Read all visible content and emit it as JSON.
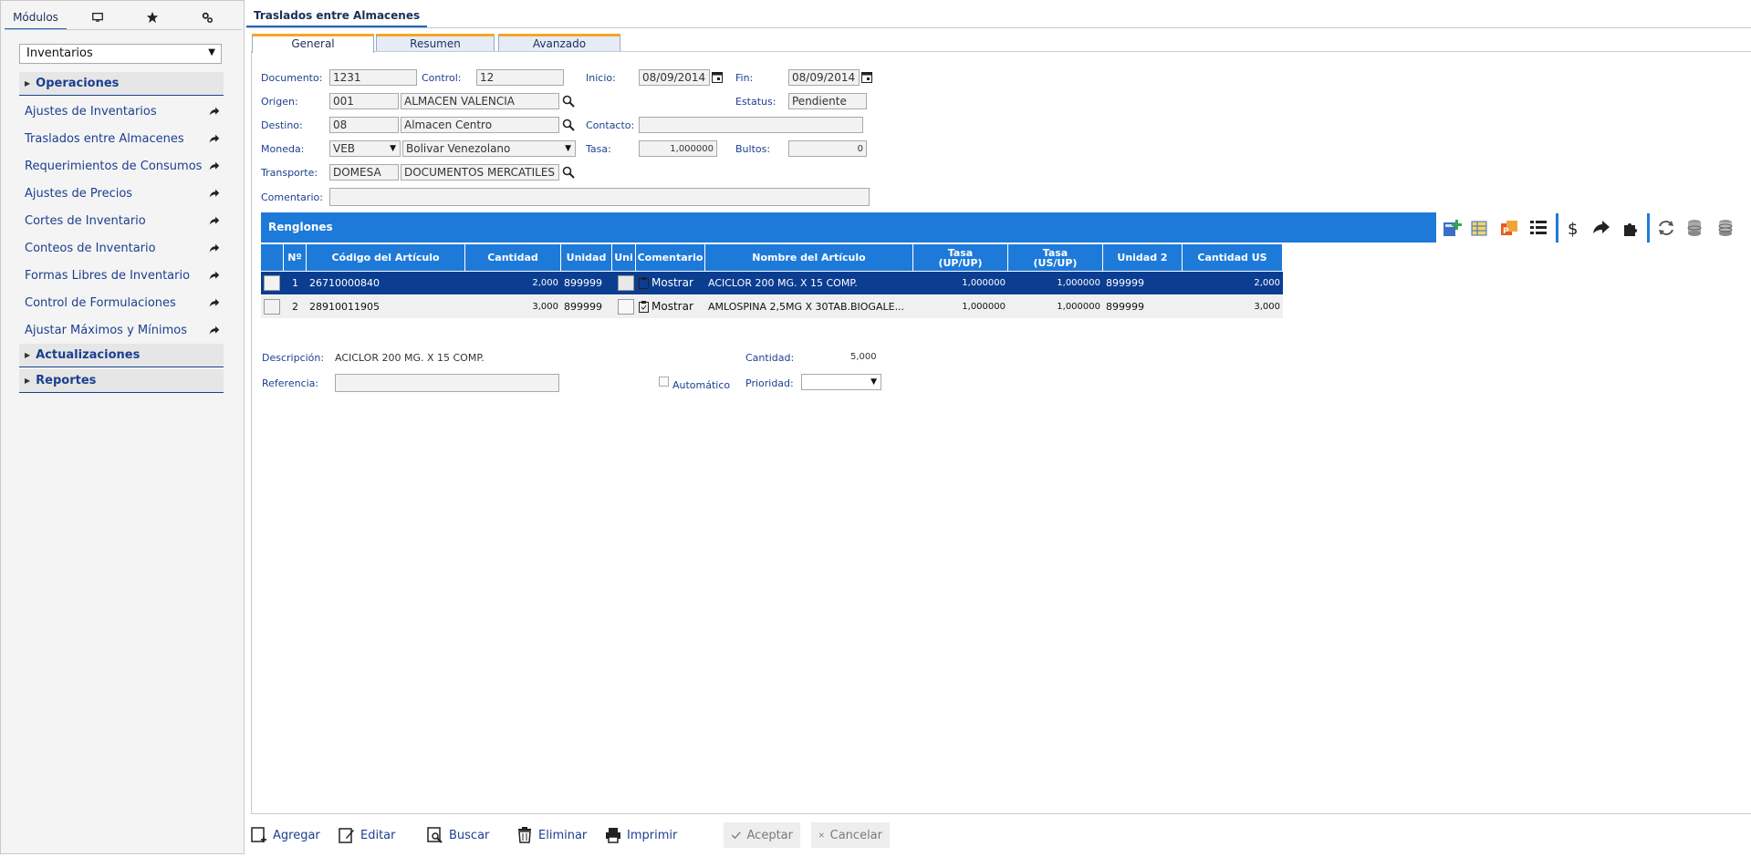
{
  "sidebar": {
    "tab_modulos": "Módulos",
    "icons": [
      "desktop-icon",
      "star-icon",
      "gear-icon"
    ],
    "module_select": "Inventarios",
    "sections": {
      "operaciones": "Operaciones",
      "actualizaciones": "Actualizaciones",
      "reportes": "Reportes"
    },
    "items": [
      "Ajustes de Inventarios",
      "Traslados entre Almacenes",
      "Requerimientos de Consumos",
      "Ajustes de Precios",
      "Cortes de Inventario",
      "Conteos de Inventario",
      "Formas Libres de Inventario",
      "Control de Formulaciones",
      "Ajustar Máximos y Mínimos"
    ]
  },
  "main": {
    "title": "Traslados entre Almacenes",
    "tabs": [
      "General",
      "Resumen",
      "Avanzado"
    ]
  },
  "form": {
    "documento_label": "Documento:",
    "documento": "1231",
    "control_label": "Control:",
    "control": "12",
    "inicio_label": "Inicio:",
    "inicio": "08/09/2014",
    "fin_label": "Fin:",
    "fin": "08/09/2014",
    "origen_label": "Origen:",
    "origen_code": "001",
    "origen_name": "ALMACEN VALENCIA",
    "estatus_label": "Estatus:",
    "estatus": "Pendiente",
    "destino_label": "Destino:",
    "destino_code": "08",
    "destino_name": "Almacen Centro",
    "contacto_label": "Contacto:",
    "contacto": "",
    "moneda_label": "Moneda:",
    "moneda_code": "VEB",
    "moneda_name": "Bolivar Venezolano",
    "tasa_label": "Tasa:",
    "tasa": "1,000000",
    "bultos_label": "Bultos:",
    "bultos": "0",
    "transporte_label": "Transporte:",
    "transporte_code": "DOMESA",
    "transporte_name": "DOCUMENTOS MERCATILES",
    "comentario_label": "Comentario:",
    "comentario": ""
  },
  "grid": {
    "title": "Renglones",
    "toolbar_icons": [
      "add-item-icon",
      "edit-grid-icon",
      "office-icon",
      "list-icon",
      "dollar-icon",
      "forward-icon",
      "puzzle-icon",
      "refresh-icon",
      "database-icon",
      "database-stack-icon"
    ],
    "headers": [
      "Nº",
      "Código del Artículo",
      "Cantidad",
      "Unidad",
      "Uni",
      "Comentario",
      "Nombre del Artículo",
      "Tasa\n(UP/UP)",
      "Tasa\n(US/UP)",
      "Unidad 2",
      "Cantidad US"
    ],
    "rows": [
      {
        "n": "1",
        "codigo": "26710000840",
        "cantidad": "2,000",
        "unidad": "899999",
        "comentario": "Mostrar",
        "nombre": "ACICLOR 200 MG. X 15 COMP.",
        "tasa1": "1,000000",
        "tasa2": "1,000000",
        "unidad2": "899999",
        "cantidad_us": "2,000"
      },
      {
        "n": "2",
        "codigo": "28910011905",
        "cantidad": "3,000",
        "unidad": "899999",
        "comentario": "Mostrar",
        "nombre": "AMLOSPINA 2,5MG X 30TAB.BIOGALE...",
        "tasa1": "1,000000",
        "tasa2": "1,000000",
        "unidad2": "899999",
        "cantidad_us": "3,000"
      }
    ]
  },
  "detail": {
    "descripcion_label": "Descripción:",
    "descripcion": "ACICLOR 200 MG. X 15 COMP.",
    "cantidad_label": "Cantidad:",
    "cantidad": "5,000",
    "referencia_label": "Referencia:",
    "referencia": "",
    "automatico_label": "Automático",
    "prioridad_label": "Prioridad:",
    "prioridad": ""
  },
  "actions": {
    "agregar": "Agregar",
    "editar": "Editar",
    "buscar": "Buscar",
    "eliminar": "Eliminar",
    "imprimir": "Imprimir",
    "aceptar": "Aceptar",
    "cancelar": "Cancelar"
  },
  "colors": {
    "accent": "#1e7ad9",
    "selected_row": "#0b3d91",
    "tab_accent": "#f5a623",
    "text": "#1c3f8f"
  }
}
